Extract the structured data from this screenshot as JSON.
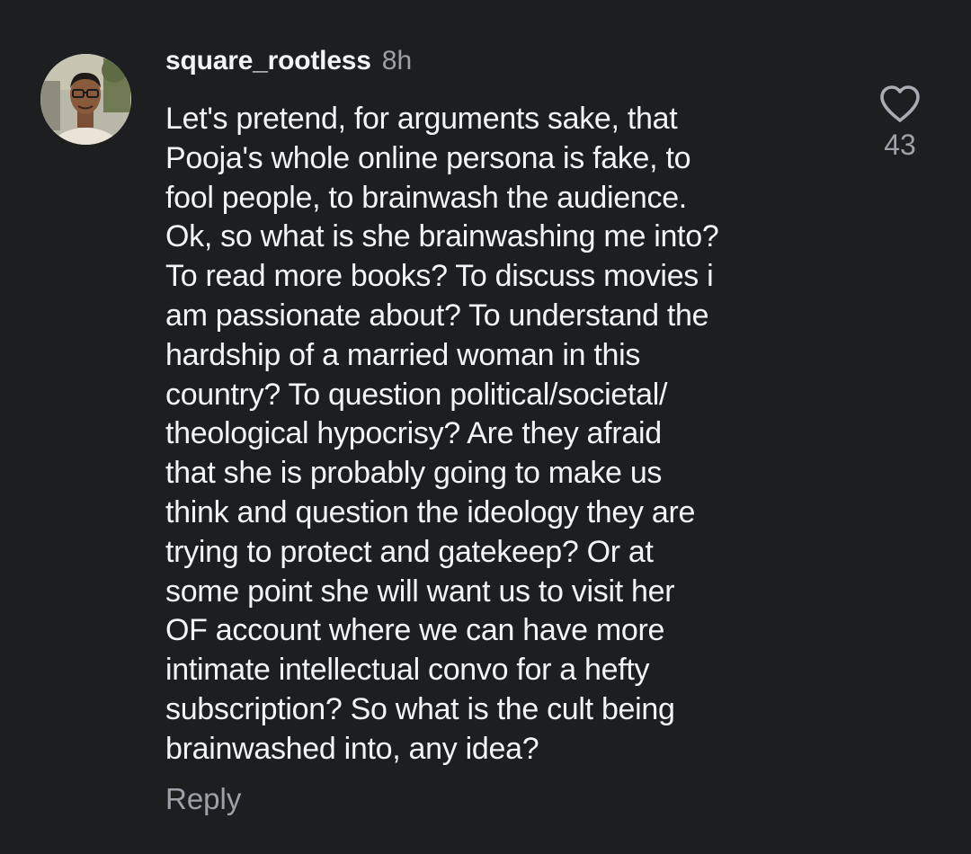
{
  "comment": {
    "username": "square_rootless",
    "timestamp": "8h",
    "lines": [
      "Let's pretend, for arguments sake, that",
      "Pooja's whole online persona is fake, to",
      "fool people, to brainwash the audience.",
      "Ok, so what is she brainwashing me into?",
      "To read more books? To discuss movies i",
      "am passionate about? To understand the",
      "hardship of a married woman in this",
      "country? To question political/societal/",
      "theological hypocrisy? Are they afraid",
      "that she is probably going to make us",
      "think and question the ideology they are",
      "trying to protect and gatekeep? Or at",
      "some point she will want us to visit her",
      "OF account where we can have more",
      "intimate intellectual convo for a hefty",
      "subscription? So what is the cult being",
      "brainwashed into, any idea?"
    ],
    "reply_label": "Reply",
    "like_count": "43",
    "like_icon": "heart-outline-icon",
    "avatar_icon": "user-avatar"
  },
  "colors": {
    "background": "#1c1e1f",
    "primary_text": "#f3f4f5",
    "secondary_text": "#9ea2a8"
  }
}
